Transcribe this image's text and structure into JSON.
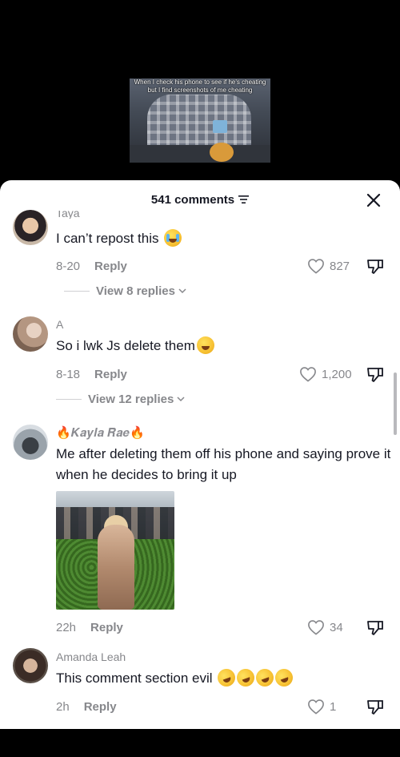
{
  "video": {
    "caption": "When I check his phone to see if he's cheating but I find screenshots of me cheating"
  },
  "sheet": {
    "comment_count": "541 comments"
  },
  "comments": [
    {
      "username": "Taya",
      "text": "I can’t repost this",
      "date": "8-20",
      "reply_label": "Reply",
      "likes": "827",
      "view_replies": "View 8 replies"
    },
    {
      "username": "A",
      "text": "So i lwk Js delete them",
      "date": "8-18",
      "reply_label": "Reply",
      "likes": "1,200",
      "view_replies": "View 12 replies"
    },
    {
      "username": "🔥𝑲𝒂𝒚𝒍𝒂 𝑹𝒂𝒆🔥",
      "text": "Me after deleting them off his phone and saying prove it when he decides to bring it up",
      "date": "22h",
      "reply_label": "Reply",
      "likes": "34"
    },
    {
      "username": "Amanda Leah",
      "text": "This comment section evil",
      "date": "2h",
      "reply_label": "Reply",
      "likes": "1"
    }
  ],
  "icons": {
    "filter": "filter-icon",
    "close": "close-icon",
    "heart": "heart-icon",
    "dislike": "dislike-icon",
    "chevron": "chevron-down-icon"
  }
}
